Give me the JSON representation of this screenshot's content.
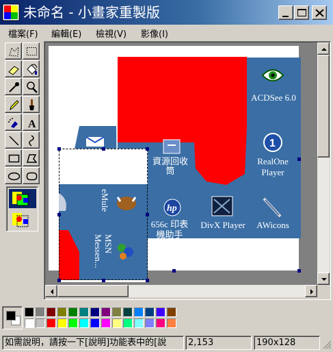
{
  "window": {
    "title": "未命名 - 小畫家重製版",
    "minimize_label": "minimize",
    "maximize_label": "maximize",
    "close_label": "close"
  },
  "menu": [
    "檔案(F)",
    "編輯(E)",
    "檢視(V)",
    "影像(I)"
  ],
  "tools": [
    {
      "name": "free-form-select-tool",
      "icon": "dotted-star-icon"
    },
    {
      "name": "rect-select-tool",
      "icon": "dotted-rect-icon"
    },
    {
      "name": "eraser-tool",
      "icon": "eraser-icon"
    },
    {
      "name": "fill-tool",
      "icon": "paint-bucket-icon"
    },
    {
      "name": "pick-color-tool",
      "icon": "eyedropper-icon"
    },
    {
      "name": "magnifier-tool",
      "icon": "magnifier-icon"
    },
    {
      "name": "pencil-tool",
      "icon": "pencil-icon"
    },
    {
      "name": "brush-tool",
      "icon": "brush-icon"
    },
    {
      "name": "airbrush-tool",
      "icon": "airbrush-icon"
    },
    {
      "name": "text-tool",
      "icon": "text-a-icon"
    },
    {
      "name": "line-tool",
      "icon": "line-icon"
    },
    {
      "name": "curve-tool",
      "icon": "curve-icon"
    },
    {
      "name": "rectangle-tool",
      "icon": "rectangle-icon"
    },
    {
      "name": "polygon-tool",
      "icon": "polygon-icon"
    },
    {
      "name": "ellipse-tool",
      "icon": "ellipse-icon"
    },
    {
      "name": "rounded-rect-tool",
      "icon": "rounded-rect-icon"
    }
  ],
  "canvas": {
    "desktop_icons": {
      "acdsee": "ACDSee 6.0",
      "recycle_bin": "資源回收筒",
      "realone": "RealOne Player",
      "printer": "656c 印表機助手",
      "divx": "DivX Player",
      "awicons": "AWicons",
      "emule": "eMule",
      "msn": "MSN Messen..."
    },
    "paint_color": "#ff0000",
    "desktop_color": "#3a6ea5"
  },
  "palette": {
    "foreground": "#000000",
    "background": "#ffffff",
    "row1": [
      "#000000",
      "#808080",
      "#800000",
      "#808000",
      "#008000",
      "#008080",
      "#000080",
      "#800080",
      "#808040",
      "#004040",
      "#0080ff",
      "#004080",
      "#4000ff",
      "#804000"
    ],
    "row2": [
      "#ffffff",
      "#c0c0c0",
      "#ff0000",
      "#ffff00",
      "#00ff00",
      "#00ffff",
      "#0000ff",
      "#ff00ff",
      "#ffff80",
      "#00ff80",
      "#80ffff",
      "#8080ff",
      "#ff0080",
      "#ff8040"
    ]
  },
  "status": {
    "help": "如需說明，請按一下[說明]功能表中的[說",
    "coords": "2,153",
    "size": "190x128"
  }
}
